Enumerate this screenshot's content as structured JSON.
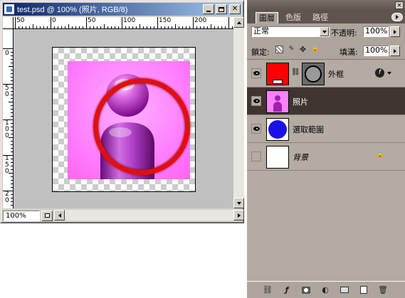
{
  "document": {
    "title": "test.psd @ 100% (照片, RGB/8)",
    "zoom": "100%",
    "ruler_h_labels": [
      "50",
      "0",
      "50",
      "100",
      "150",
      "200"
    ],
    "ruler_v_labels": [
      "0",
      "5 0",
      "1 0 0",
      "1 5 0",
      "2 0"
    ]
  },
  "panel": {
    "tabs": [
      "圖層",
      "色版",
      "路徑"
    ],
    "active_tab": "圖層",
    "blend_mode": "正常",
    "opacity_label": "不透明:",
    "opacity_value": "100%",
    "lock_label": "鎖定:",
    "fill_label": "填滿:",
    "fill_value": "100%",
    "layers": [
      {
        "name": "外框",
        "visible": true,
        "selected": false,
        "has_mask": true,
        "has_fx": true,
        "thumb_color": "#ff0000"
      },
      {
        "name": "照片",
        "visible": true,
        "selected": true,
        "thumb_color": "#ff66ff"
      },
      {
        "name": "選取範圍",
        "visible": true,
        "selected": false,
        "thumb_color": "#1a10e8"
      },
      {
        "name": "背景",
        "visible": false,
        "selected": false,
        "locked": true,
        "italic": true,
        "thumb_color": "#ffffff"
      }
    ]
  },
  "colors": {
    "title_bar_start": "#0a246a",
    "title_bar_end": "#a6caf0",
    "panel_bg": "#ada49c",
    "selected_layer": "#3e3531",
    "frame_red": "#e01010",
    "photo_pink": "#ff80ff"
  }
}
